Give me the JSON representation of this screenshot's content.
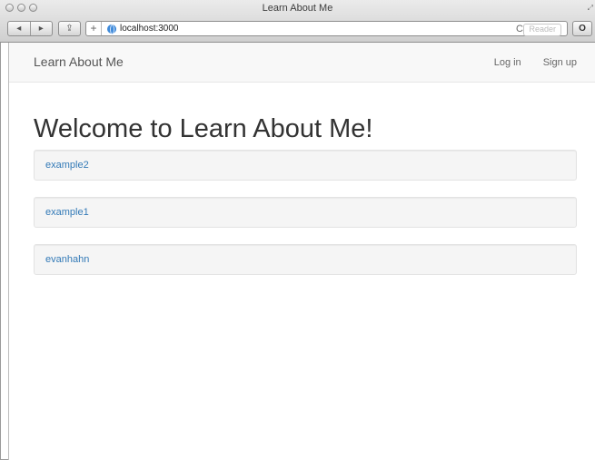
{
  "window": {
    "title": "Learn About Me"
  },
  "toolbar": {
    "back_label": "◂",
    "forward_label": "▸",
    "share_label": "⇪",
    "new_tab_label": "+",
    "url": "localhost:3000",
    "reload_label": "C",
    "reader_label": "Reader",
    "extension_label": "O"
  },
  "navbar": {
    "brand": "Learn About Me",
    "links": [
      "Log in",
      "Sign up"
    ]
  },
  "main": {
    "heading": "Welcome to Learn About Me!",
    "users": [
      "example2",
      "example1",
      "evanhahn"
    ]
  },
  "colors": {
    "link": "#337ab7",
    "navbar_bg": "#f8f8f8",
    "well_bg": "#f5f5f5"
  }
}
